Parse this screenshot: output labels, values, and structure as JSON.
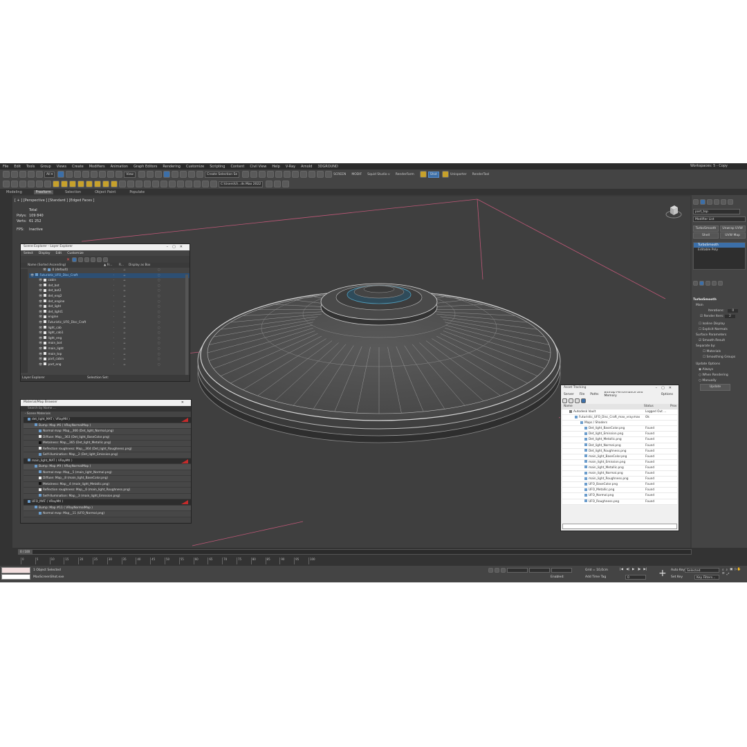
{
  "menu": [
    "File",
    "Edit",
    "Tools",
    "Group",
    "Views",
    "Create",
    "Modifiers",
    "Animation",
    "Graph Editors",
    "Rendering",
    "Customize",
    "Scripting",
    "Content",
    "Civil View",
    "Help",
    "V-Ray",
    "Arnold",
    "3DGROUND"
  ],
  "workspace": "Workspaces:  5 - Copy",
  "toolbar": {
    "view_select": "View",
    "selection_set": "Create Selection Se",
    "screen": "SCREEN",
    "modif": "MODIF",
    "squid": "Squid Studio v",
    "renderfarm": "RenderFarm",
    "shot": "Shot",
    "unisporter": "Unisporter",
    "rendertool": "RenderTool",
    "path": "C:\\Users\\U\\...ds Max 2022"
  },
  "ribbon": [
    "Modeling",
    "Freeform",
    "Selection",
    "Object Paint",
    "Populate"
  ],
  "viewport": {
    "label": "[ + ] [Perspective ] [Standard ] [Edged Faces ]",
    "stats": {
      "total_label": "Total",
      "polys_label": "Polys:",
      "polys": "109 840",
      "verts_label": "Verts:",
      "verts": "61 252",
      "fps_label": "FPS:",
      "fps": "Inactive"
    }
  },
  "scene_explorer": {
    "title": "Scene Explorer - Layer Explorer",
    "menu": [
      "Select",
      "Display",
      "Edit",
      "Customize"
    ],
    "col_name": "Name (Sorted Ascending)",
    "col_fr": "▲ Fr...",
    "col_r": "R...",
    "col_box": "Display as Box",
    "rows": [
      "0 (default)",
      "Futuristic_UFO_Disc_Craft",
      "cabin",
      "det_bot",
      "det_bot2",
      "det_eng2",
      "det_engine",
      "det_light",
      "det_light1",
      "engine",
      "Futuristic_UFO_Disc_Craft",
      "light_cab",
      "light_cab1",
      "light_eng",
      "main_bot",
      "main_light",
      "main_top",
      "part_cabin",
      "part_eng"
    ],
    "footer_left": "Layer Explorer",
    "footer_sel": "Selection Set:"
  },
  "material_browser": {
    "title": "Material/Map Browser",
    "search": "Search by Name ...",
    "section": "- Scene Materials",
    "rows": [
      {
        "kind": "head",
        "text": "det_light_MAT  ( VRayMtl )"
      },
      {
        "kind": "sub",
        "text": "Bump: Map #6  ( VRayNormalMap )"
      },
      {
        "kind": "leaf",
        "text": "Normal map: Map__366 (Det_light_Normal.png)"
      },
      {
        "kind": "leaf",
        "text": "Diffuse: Map__363 (Det_light_BaseColor.png)"
      },
      {
        "kind": "leaf",
        "text": "Metalness: Map__365 (Det_light_Metallic.png)"
      },
      {
        "kind": "leaf",
        "text": "Reflection roughness: Map__364 (Det_light_Roughness.png)"
      },
      {
        "kind": "leaf",
        "text": "Self-illumination: Map__2 (Det_light_Emission.png)"
      },
      {
        "kind": "head",
        "text": "main_light_MAT  ( VRayMtl )"
      },
      {
        "kind": "sub",
        "text": "Bump: Map #9  ( VRayNormalMap )"
      },
      {
        "kind": "leaf",
        "text": "Normal map: Map__5 (main_light_Normal.png)"
      },
      {
        "kind": "leaf",
        "text": "Diffuse: Map__8 (main_light_BaseColor.png)"
      },
      {
        "kind": "leaf",
        "text": "Metalness: Map__4 (main_light_Metallic.png)"
      },
      {
        "kind": "leaf",
        "text": "Reflection roughness: Map__6 (main_light_Roughness.png)"
      },
      {
        "kind": "leaf",
        "text": "Self-illumination: Map__3 (main_light_Emission.png)"
      },
      {
        "kind": "head",
        "text": "UFO_MAT  ( VRayMtl )"
      },
      {
        "kind": "sub",
        "text": "Bump: Map #11  ( VRayNormalMap )"
      },
      {
        "kind": "leaf",
        "text": "Normal map: Map__11 (UFO_Normal.png)"
      }
    ]
  },
  "asset_tracking": {
    "title": "Asset Tracking",
    "menu": [
      "Server",
      "File",
      "Paths",
      "Bitmap Performance and Memory",
      "Options"
    ],
    "col_name": "Name",
    "col_status": "Status",
    "col_prov": "Prov",
    "rows": [
      {
        "name": "Autodesk Vault",
        "status": "Logged Out ..."
      },
      {
        "name": "Futuristic_UFO_Disc_Craft_max_vray.max",
        "status": "Ok"
      },
      {
        "name": "Maps / Shaders",
        "status": ""
      },
      {
        "name": "Det_light_BaseColor.png",
        "status": "Found"
      },
      {
        "name": "Det_light_Emission.png",
        "status": "Found"
      },
      {
        "name": "Det_light_Metallic.png",
        "status": "Found"
      },
      {
        "name": "Det_light_Normal.png",
        "status": "Found"
      },
      {
        "name": "Det_light_Roughness.png",
        "status": "Found"
      },
      {
        "name": "main_light_BaseColor.png",
        "status": "Found"
      },
      {
        "name": "main_light_Emission.png",
        "status": "Found"
      },
      {
        "name": "main_light_Metallic.png",
        "status": "Found"
      },
      {
        "name": "main_light_Normal.png",
        "status": "Found"
      },
      {
        "name": "main_light_Roughness.png",
        "status": "Found"
      },
      {
        "name": "UFO_BaseColor.png",
        "status": "Found"
      },
      {
        "name": "UFO_Metallic.png",
        "status": "Found"
      },
      {
        "name": "UFO_Normal.png",
        "status": "Found"
      },
      {
        "name": "UFO_Roughness.png",
        "status": "Found"
      }
    ]
  },
  "command_panel": {
    "object_name": "part_top",
    "modifier_list": "Modifier List",
    "buttons": [
      "TurboSmooth",
      "Unwrap UVW",
      "Shell",
      "UVW Map"
    ],
    "stack": [
      "TurboSmooth",
      "Editable Poly"
    ],
    "rollout_title": "TurboSmooth",
    "main": "Main",
    "iterations_label": "Iterations:",
    "iterations": "0",
    "render_iters_label": "Render Iters:",
    "render_iters": "2",
    "isoline": "Isoline Display",
    "explicit": "Explicit Normals",
    "surface": "Surface Parameters",
    "smooth_result": "Smooth Result",
    "separate": "Separate by:",
    "materials": "Materials",
    "smoothing": "Smoothing Groups",
    "update_options": "Update Options",
    "always": "Always",
    "when_rendering": "When Rendering",
    "manually": "Manually",
    "update": "Update"
  },
  "timeline": {
    "frame": "0 / 100",
    "ticks": [
      "0",
      "5",
      "10",
      "15",
      "20",
      "25",
      "30",
      "35",
      "40",
      "45",
      "50",
      "55",
      "60",
      "65",
      "70",
      "75",
      "80",
      "85",
      "90",
      "95",
      "100"
    ]
  },
  "status": {
    "selected": "1 Object Selected",
    "exe": "MaxScreenShot.exe",
    "grid": "Grid = 10,0cm",
    "enabled": "Enabled:",
    "add_time_tag": "Add Time Tag",
    "auto_key": "Auto Key",
    "selected_dd": "Selected",
    "set_key": "Set Key",
    "key_filters": "Key Filters...",
    "frame_field": "0"
  },
  "colors": {
    "accent": "#3c6fa8",
    "warning": "#c52b2b",
    "viewport_bg": "#3f3f3f"
  }
}
